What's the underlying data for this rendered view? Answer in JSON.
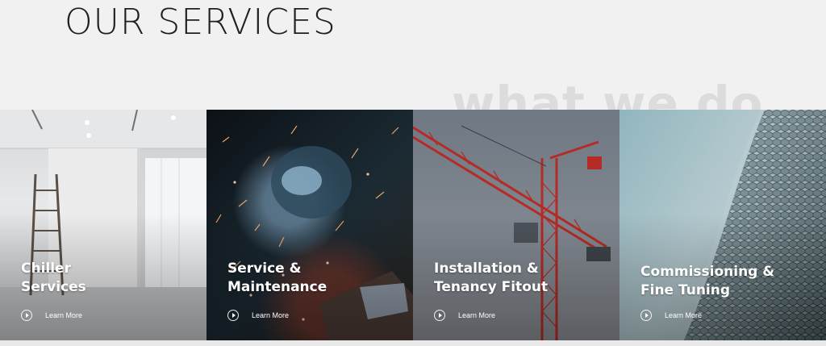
{
  "section": {
    "title": "OUR SERVICES",
    "watermark": "what we do"
  },
  "cards": [
    {
      "title_line1": "Chiller",
      "title_line2": "Services",
      "cta": "Learn More",
      "image": "empty-gallery-with-ladder"
    },
    {
      "title_line1": "Service &",
      "title_line2": "Maintenance",
      "cta": "Learn More",
      "image": "welder-sparks"
    },
    {
      "title_line1": "Installation &",
      "title_line2": "Tenancy Fitout",
      "cta": "Learn More",
      "image": "red-construction-crane"
    },
    {
      "title_line1": "Commissioning &",
      "title_line2": "Fine Tuning",
      "cta": "Learn More",
      "image": "hexagon-tiled-building"
    }
  ],
  "icons": {
    "cta": "play-circle-icon"
  },
  "colors": {
    "text_dark": "#1f1f1f",
    "page_bg": "#f1f1f1",
    "crane_red": "#c0392b"
  }
}
